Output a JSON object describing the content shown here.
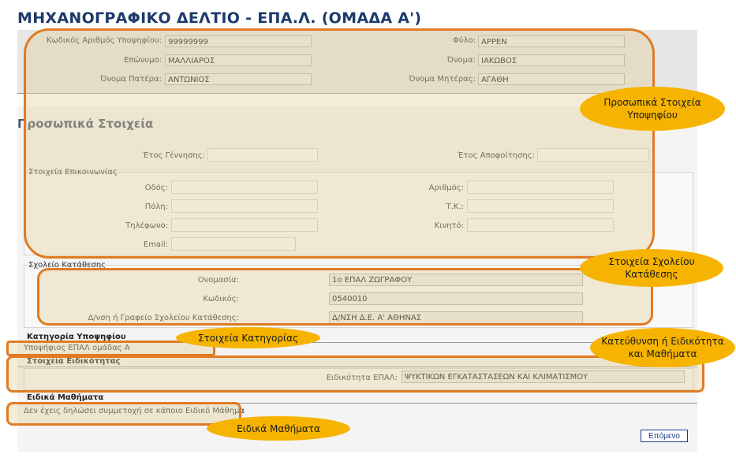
{
  "page_title": "ΜΗΧΑΝΟΓΡΑΦΙΚΟ ΔΕΛΤΙΟ - ΕΠΑ.Λ. (ΟΜΑΔΑ Α')",
  "header": {
    "candidate_code_label": "Κωδικός Αριθμός Υποψηφίου:",
    "candidate_code": "99999999",
    "gender_label": "Φύλο:",
    "gender": "ΑΡΡΕΝ",
    "surname_label": "Επώνυμο:",
    "surname": "ΜΑΛΛΙΑΡΟΣ",
    "name_label": "Όνομα:",
    "name": "ΙΑΚΩΒΟΣ",
    "father_label": "Όνομα Πατέρα:",
    "father": "ΑΝΤΩΝΙΟΣ",
    "mother_label": "Όνομα Μητέρας:",
    "mother": "ΑΓΑΘΗ"
  },
  "personal": {
    "title": "Προσωπικά Στοιχεία",
    "birth_year_label": "Έτος Γέννησης:",
    "birth_year": "",
    "grad_year_label": "Έτος Αποφοίτησης:",
    "grad_year": "",
    "contact_title": "Στοιχεία Επικοινωνίας",
    "street_label": "Οδός:",
    "number_label": "Αριθμός:",
    "city_label": "Πόλη:",
    "postcode_label": "Τ.Κ.:",
    "phone_label": "Τηλέφωνο:",
    "mobile_label": "Κινητό:",
    "email_label": "Email:"
  },
  "school": {
    "title": "Σχολείο Κατάθεσης",
    "name_label": "Ονομασία:",
    "name": "1ο  ΕΠΑΛ  ΖΩΓΡΑΦΟΥ",
    "code_label": "Κωδικός:",
    "code": "0540010",
    "directorate_label": "Δ/νση ή Γραφείο Σχολείου Κατάθεσης:",
    "directorate": "Δ/ΝΣΗ Δ.Ε. Α' ΑΘΗΝΑΣ"
  },
  "category": {
    "title": "Κατηγορία Υποψηφίου",
    "value": "Υποψήφιος ΕΠΑΛ ομάδας Α"
  },
  "specialty": {
    "title": "Στοιχεία Ειδικότητας",
    "label": "Ειδικότητα ΕΠΑΛ:",
    "value": "ΨΥΚΤΙΚΩΝ ΕΓΚΑΤΑΣΤΑΣΕΩΝ ΚΑΙ ΚΛΙΜΑΤΙΣΜΟΥ"
  },
  "special_courses": {
    "title": "Ειδικά Μαθήματα",
    "value": "Δεν έχεις δηλώσει συμμετοχή σε κάποιο Ειδικό Μάθημα"
  },
  "buttons": {
    "next": "Επόμενο"
  },
  "callouts": {
    "personal": "Προσωπικά Στοιχεία Υποψηφίου",
    "school": "Στοιχεία Σχολείου Κατάθεσης",
    "category": "Στοιχεία Κατηγορίας",
    "specialty": "Κατεύθυνση ή Ειδικότητα και Μαθήματα",
    "special": "Ειδικά Μαθήματα"
  },
  "colors": {
    "title": "#1d3a6b",
    "highlight_border": "#e07b24",
    "callout_fill": "#f6b400",
    "button_border": "#1e3a8a"
  }
}
